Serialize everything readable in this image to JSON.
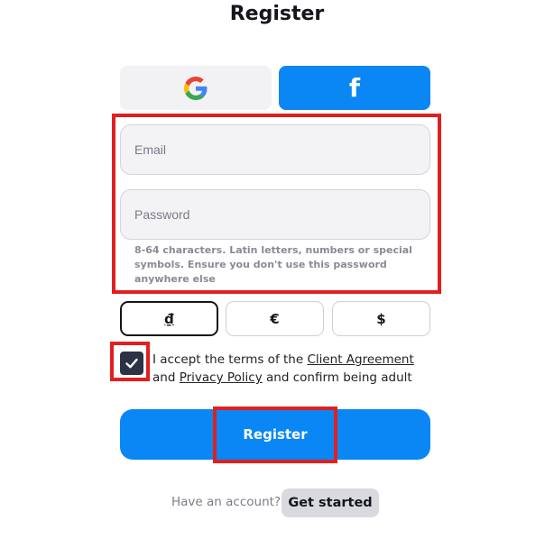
{
  "page": {
    "title": "Register"
  },
  "social": {
    "google": {
      "icon": "google-icon"
    },
    "facebook": {
      "icon": "facebook-icon",
      "glyph": "f"
    }
  },
  "form": {
    "email": {
      "placeholder": "Email",
      "value": ""
    },
    "password": {
      "placeholder": "Password",
      "value": ""
    },
    "password_hint": "8-64 characters. Latin letters, numbers or special symbols. Ensure you don't use this password anywhere else"
  },
  "currencies": {
    "selected": "₫",
    "options": [
      {
        "symbol": "₫"
      },
      {
        "symbol": "€"
      },
      {
        "symbol": "$"
      }
    ]
  },
  "terms": {
    "checked": true,
    "prefix": "I accept the terms of the ",
    "client_agreement": "Client Agreement",
    "and": " and ",
    "privacy_policy": "Privacy Policy",
    "suffix": " and confirm being adult"
  },
  "register_button": {
    "label": "Register"
  },
  "footer": {
    "have_account": "Have an account?",
    "get_started": "Get started"
  },
  "colors": {
    "accent": "#0b86f5",
    "highlight": "#e0201f",
    "checkbox": "#2c3345"
  }
}
